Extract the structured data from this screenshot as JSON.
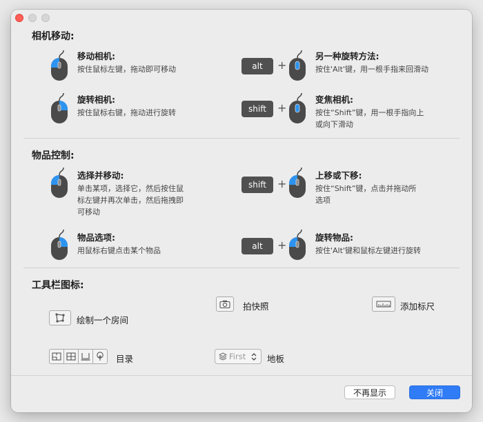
{
  "window": {
    "controls": [
      "close",
      "minimize",
      "zoom"
    ]
  },
  "camera_section": {
    "title": "相机移动:",
    "items": [
      {
        "title": "移动相机:",
        "desc": [
          "按住鼠标左键，拖动即可移动"
        ],
        "mouse": "left-button"
      },
      {
        "title": "另一种旋转方法:",
        "desc": [
          "按住'Alt'键，用一根手指来回滑动"
        ],
        "key": "alt",
        "mouse": "scroll"
      },
      {
        "title": "旋转相机:",
        "desc": [
          "按住鼠标右键，拖动进行旋转"
        ],
        "mouse": "right-button"
      },
      {
        "title": "变焦相机:",
        "desc": [
          "按住“Shift”键，用一根手指向上",
          "或向下滑动"
        ],
        "key": "shift",
        "mouse": "scroll"
      }
    ]
  },
  "object_section": {
    "title": "物品控制:",
    "items": [
      {
        "title": "选择并移动:",
        "desc": [
          "单击某项，选择它，然后按住鼠",
          "标左键并再次单击，然后拖拽即",
          "可移动"
        ],
        "mouse": "left-button"
      },
      {
        "title": "上移或下移:",
        "desc": [
          "按住“Shift”键，点击并拖动所",
          "选项"
        ],
        "key": "shift",
        "mouse": "left-button"
      },
      {
        "title": "物品选项:",
        "desc": [
          "用鼠标右键点击某个物品"
        ],
        "mouse": "right-button"
      },
      {
        "title": "旋转物品:",
        "desc": [
          "按住'Alt'键和鼠标左键进行旋转"
        ],
        "key": "alt",
        "mouse": "left-button"
      }
    ]
  },
  "toolbar_section": {
    "title": "工具栏图标:",
    "draw_room": {
      "label": "绘制一个房间",
      "icon": "draw-room-icon"
    },
    "snapshot": {
      "label": "拍快照",
      "icon": "camera-icon"
    },
    "add_ruler": {
      "label": "添加标尺",
      "icon": "ruler-icon"
    },
    "catalog": {
      "label": "目录",
      "icons": [
        "floorplan-2d-icon",
        "grid-icon",
        "elevation-icon",
        "tree-icon"
      ]
    },
    "floor": {
      "label": "地板",
      "selected": "First",
      "icon": "layers-icon"
    }
  },
  "footer": {
    "dont_show_again": "不再显示",
    "close": "关闭"
  },
  "colors": {
    "accent": "#2f7cf6",
    "mouse_body": "#4a4a4a",
    "mouse_highlight": "#2d93f0",
    "key_bg": "#505050"
  }
}
